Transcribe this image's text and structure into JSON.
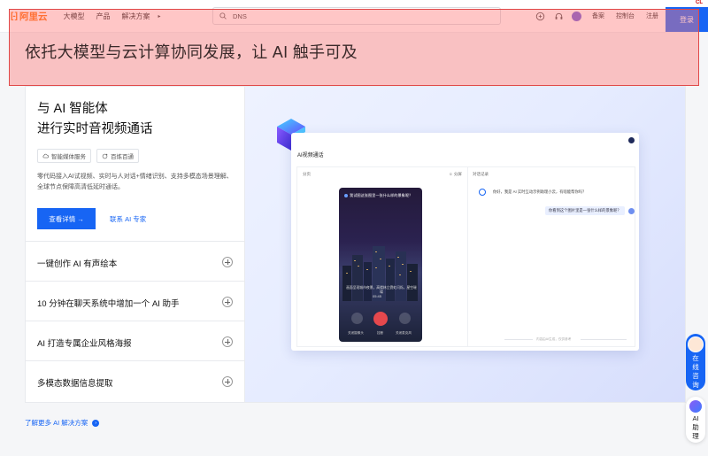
{
  "nav": {
    "logo_mark": "[-]",
    "logo_text": "阿里云",
    "items": [
      "大模型",
      "产品",
      "解决方案"
    ],
    "more_glyph": "▸",
    "search_value": "DNS",
    "links": [
      "备案",
      "控制台",
      "注册"
    ],
    "login": "登录",
    "corner_tag": "CL"
  },
  "overlay": {
    "title": "依托大模型与云计算协同发展，让 AI 触手可及"
  },
  "hero": {
    "title_line1": "与 AI 智能体",
    "title_line2": "进行实时音视频通话",
    "tags": [
      "智能媒体服务",
      "百炼百通"
    ],
    "description": "零代码接入AI试视频、实时与人对话+情绪识别、支持多模态场景理解、全球节点保障高清低延时通话。",
    "cta_primary": "查看详情 →",
    "cta_secondary": "联系 AI 专家"
  },
  "accordion": [
    "一键创作 AI 有声绘本",
    "10 分钟在聊天系统中增加一个 AI 助手",
    "AI 打造专属企业风格海报",
    "多模态数据信息提取"
  ],
  "demo": {
    "window_title": "AI视频通话",
    "pane_left_head": "分页",
    "pane_mid_head": "☺ 分屏",
    "pane_right_head": "对话记录",
    "phone_question": "我试图这张图里一张什么样的景象呢？",
    "phone_caption": "画面呈现城市夜景，高楼林立霓虹闪烁，星空璀璨",
    "phone_time": "05:45",
    "phone_labels": [
      "关闭摄像头",
      "挂断",
      "关闭麦克风"
    ],
    "chat_ai": "你好，我是 AI 实时互动示例助理小云，有啥能帮你吗？",
    "chat_user": "你看到这个图片里是一张什么样的景象呢？",
    "footnote": "内容由AI生成，仅供参考"
  },
  "more_link": "了解更多 AI 解决方案",
  "floats": {
    "consult": [
      "在",
      "线",
      "咨",
      "询"
    ],
    "ai": [
      "AI",
      "助",
      "理"
    ]
  },
  "colors": {
    "brand": "#ff6a00",
    "primary": "#1765f4",
    "overlay": "#ff7878"
  }
}
